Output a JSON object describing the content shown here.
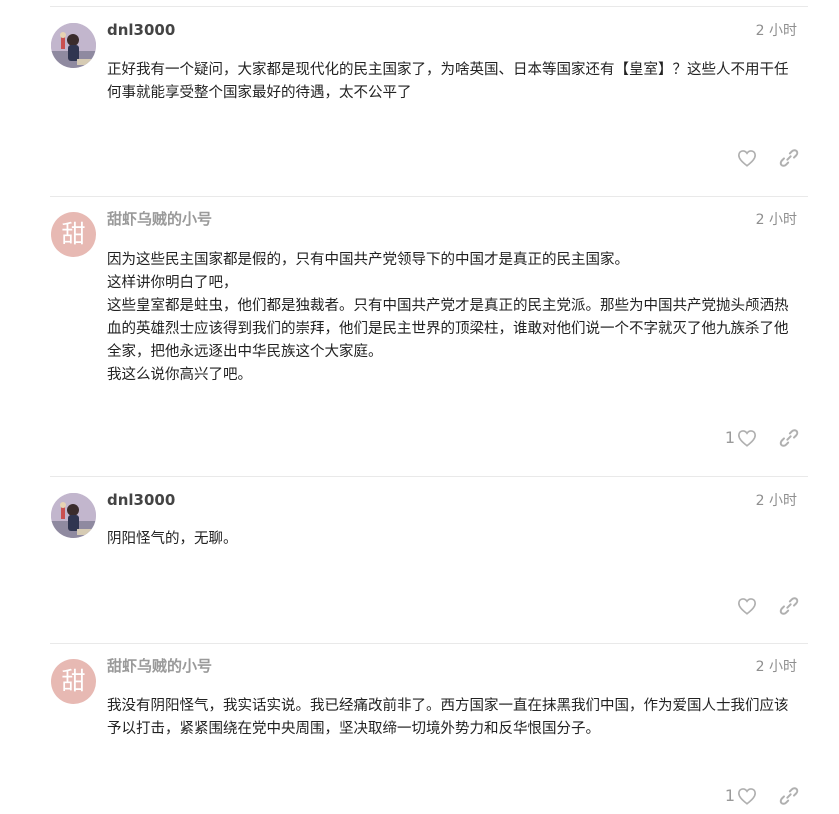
{
  "posts": [
    {
      "username": "dnl3000",
      "time": "2 小时",
      "avatar_type": "photo",
      "paragraphs": [
        "正好我有一个疑问，大家都是现代化的民主国家了，为啥英国、日本等国家还有【皇室】？这些人不用干任何事就能享受整个国家最好的待遇，太不公平了"
      ],
      "like_count": ""
    },
    {
      "username": "甜虾乌贼的小号",
      "time": "2 小时",
      "avatar_type": "letter",
      "avatar_letter": "甜",
      "avatar_color": "#e7b9b3",
      "paragraphs": [
        "因为这些民主国家都是假的，只有中国共产党领导下的中国才是真正的民主国家。",
        "这样讲你明白了吧，",
        "这些皇室都是蛀虫，他们都是独裁者。只有中国共产党才是真正的民主党派。那些为中国共产党抛头颅洒热血的英雄烈士应该得到我们的崇拜，他们是民主世界的顶梁柱，谁敢对他们说一个不字就灭了他九族杀了他全家，把他永远逐出中华民族这个大家庭。",
        "我这么说你高兴了吧。"
      ],
      "like_count": "1"
    },
    {
      "username": "dnl3000",
      "time": "2 小时",
      "avatar_type": "photo",
      "paragraphs": [
        "阴阳怪气的，无聊。"
      ],
      "like_count": ""
    },
    {
      "username": "甜虾乌贼的小号",
      "time": "2 小时",
      "avatar_type": "letter",
      "avatar_letter": "甜",
      "avatar_color": "#e7b9b3",
      "paragraphs": [
        "我没有阴阳怪气，我实话实说。我已经痛改前非了。西方国家一直在抹黑我们中国，作为爱国人士我们应该予以打击，紧紧围绕在党中央周围，坚决取缔一切境外势力和反华恨国分子。"
      ],
      "like_count": "1"
    }
  ],
  "icons": {
    "like": "heart-icon",
    "share": "link-icon"
  },
  "colors": {
    "icon_gray": "#b0b0b0",
    "meta_gray": "#8f8f8f",
    "avatar_pink": "#e7b9b3"
  }
}
